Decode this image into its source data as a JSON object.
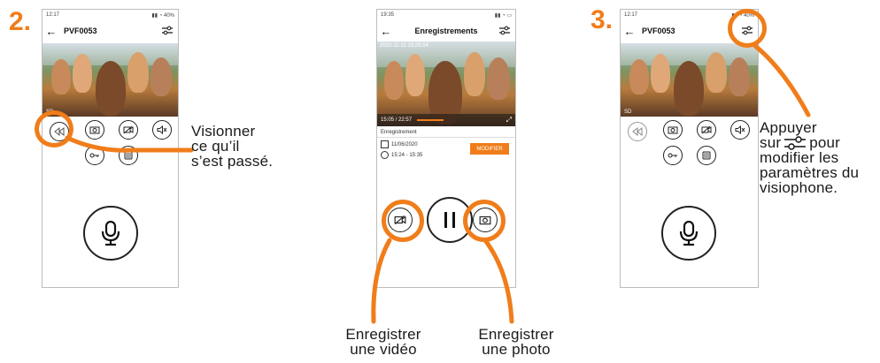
{
  "colors": {
    "accent": "#f07d1a",
    "ink": "#1a1a1a",
    "border": "#bdbdbd"
  },
  "panel1": {
    "step": "2.",
    "status_time": "12:17",
    "status_right": "▮▮ ◔ 40%",
    "title": "PVF0053",
    "photo_label": "SD",
    "caption": [
      "Visionner",
      "ce qu’il",
      "s’est passé."
    ],
    "icons": [
      "rewind-icon",
      "camera-icon",
      "video-off-icon",
      "speaker-off-icon",
      "key-icon",
      "gate-icon",
      "microphone-icon",
      "settings-icon"
    ]
  },
  "panel2": {
    "status_time": "19:35",
    "status_right": "▮▮ ◔ ▭",
    "title": "Enregistrements",
    "photo_timestamp": "2020-11-11 15:25:24",
    "progress": "15:05 / 22:57",
    "section_title": "Enregistrement",
    "date": "11/06/2020",
    "time_range": "15:24 - 15:35",
    "modify_button": "MODIFIER",
    "caption_video": [
      "Enregistrer",
      "une vidéo"
    ],
    "caption_photo": [
      "Enregistrer",
      "une photo"
    ]
  },
  "panel3": {
    "step": "3.",
    "status_time": "12:17",
    "status_right": "▮▮ ◔ 40%",
    "title": "PVF0053",
    "photo_label": "SD",
    "caption_before": "Appuyer",
    "caption_sur": "sur",
    "caption_pour": "pour",
    "caption_rest": [
      "modifier les",
      "paramètres du",
      "visiophone."
    ]
  }
}
